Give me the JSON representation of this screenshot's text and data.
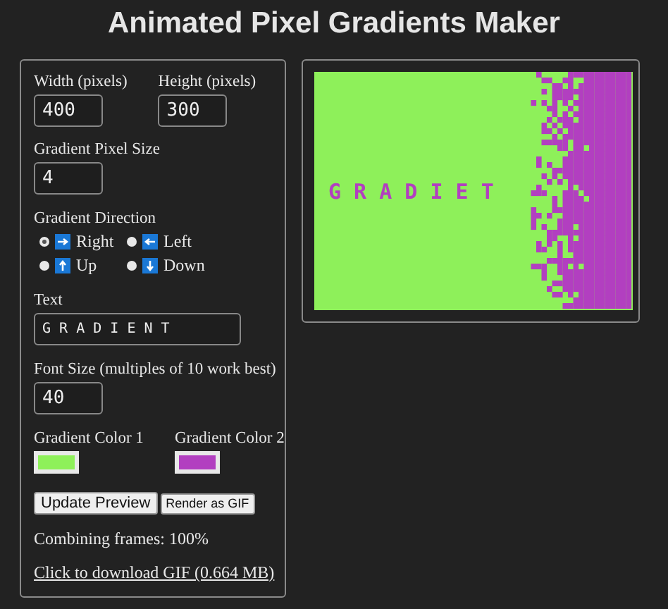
{
  "title": "Animated Pixel Gradients Maker",
  "width": {
    "label": "Width (pixels)",
    "value": "400"
  },
  "height": {
    "label": "Height (pixels)",
    "value": "300"
  },
  "pixel_size": {
    "label": "Gradient Pixel Size",
    "value": "4"
  },
  "direction": {
    "label": "Gradient Direction",
    "options": [
      {
        "label": "Right",
        "kind": "right",
        "selected": true
      },
      {
        "label": "Left",
        "kind": "left",
        "selected": false
      },
      {
        "label": "Up",
        "kind": "up",
        "selected": false
      },
      {
        "label": "Down",
        "kind": "down",
        "selected": false
      }
    ]
  },
  "text": {
    "label": "Text",
    "value": "G R A D I E N T"
  },
  "font_size": {
    "label": "Font Size (multiples of 10 work best)",
    "value": "40"
  },
  "colors": [
    {
      "label": "Gradient Color 1",
      "color": "#8ef05a"
    },
    {
      "label": "Gradient Color 2",
      "color": "#b23fc0"
    }
  ],
  "buttons": [
    {
      "label": "Update Preview",
      "kind": "large"
    },
    {
      "label": "Render as GIF",
      "kind": "small"
    }
  ],
  "status": "Combining frames: 100%",
  "download_link": "Click to download GIF (0.664 MB)",
  "preview": {
    "text": "G R A D I E   T"
  }
}
